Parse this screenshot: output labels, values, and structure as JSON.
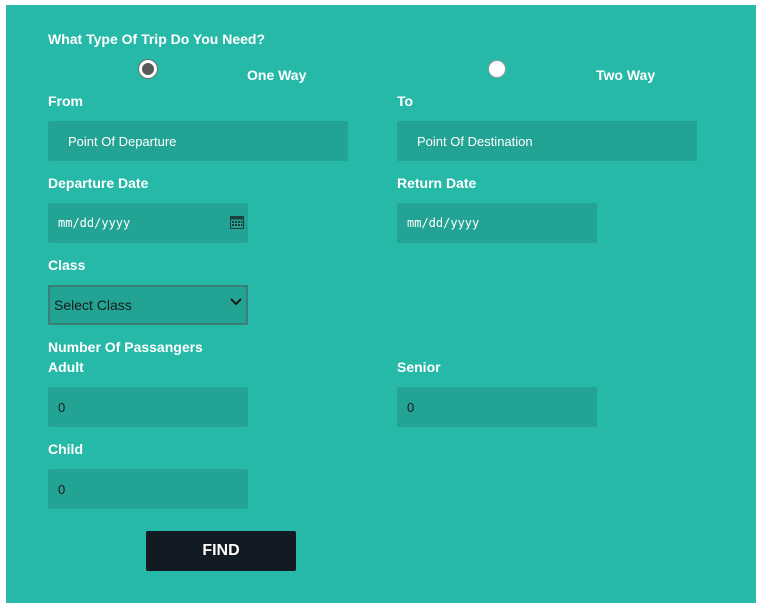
{
  "form": {
    "trip_question": "What Type Of Trip Do You Need?",
    "trip_options": [
      {
        "label": "One Way",
        "checked": true
      },
      {
        "label": "Two Way",
        "checked": false
      }
    ],
    "from_label": "From",
    "to_label": "To",
    "from_placeholder": "Point Of Departure",
    "to_placeholder": "Point Of Destination",
    "departure_date_label": "Departure Date",
    "return_date_label": "Return Date",
    "date_placeholder": "mm/dd/yyyy",
    "class_label": "Class",
    "class_selected": "Select Class",
    "passengers_label": "Number Of Passangers",
    "adult_label": "Adult",
    "senior_label": "Senior",
    "child_label": "Child",
    "adult_value": "0",
    "senior_value": "0",
    "child_value": "0",
    "find_label": "FIND"
  },
  "colors": {
    "panel_bg": "#27b9a8",
    "field_bg": "#22a394",
    "button_bg": "#121a23"
  },
  "icons": {
    "calendar": "calendar-icon",
    "select_arrow": "chevron-down-icon"
  }
}
